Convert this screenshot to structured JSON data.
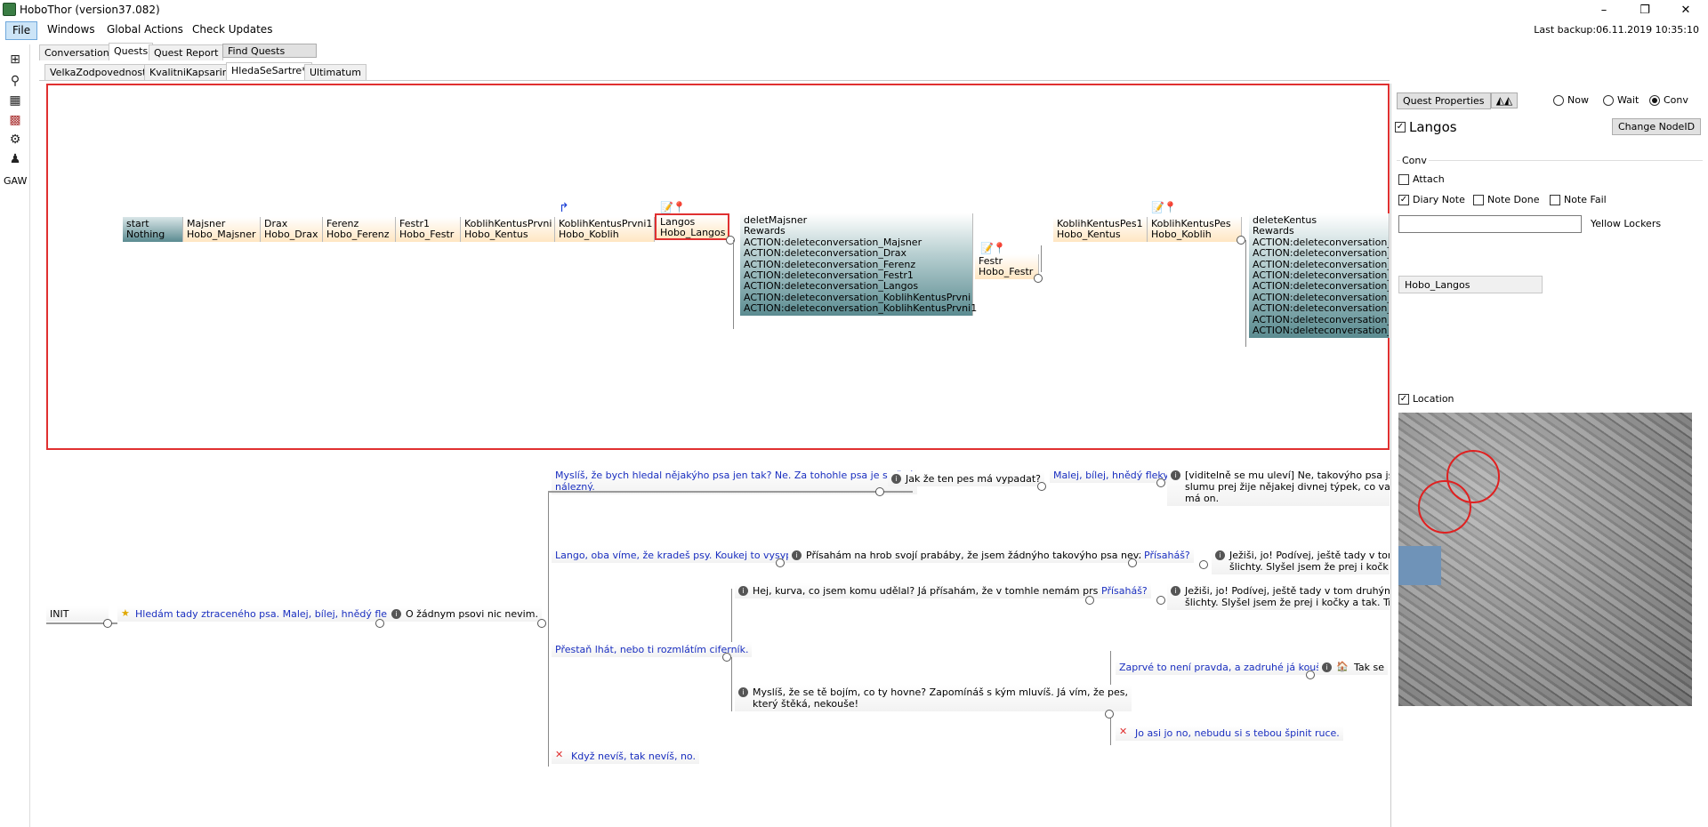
{
  "app": {
    "title": "HoboThor (version37.082)",
    "last_backup": "Last backup:06.11.2019 10:35:10",
    "controls": [
      "–",
      "❐",
      "✕"
    ]
  },
  "menu": [
    "File",
    "Windows",
    "Global Actions",
    "Check Updates"
  ],
  "left_toolbar": {
    "icons": [
      "add-node-icon",
      "fork-icon",
      "map-pin-icon",
      "map-icon",
      "gear-map-icon",
      "person-walk-icon"
    ],
    "gaw_label": "GAW"
  },
  "main_tabs": [
    "Conversations",
    "Quests",
    "Quest Report"
  ],
  "find_quests": "Find Quests",
  "quest_tabs": [
    "VelkaZodpovednost*",
    "KvalitniKapsarina",
    "HledaSeSartre*",
    "Ultimatum"
  ],
  "quest_nodes": [
    {
      "title": "start",
      "subtitle": "Nothing"
    },
    {
      "title": "Majsner",
      "subtitle": "Hobo_Majsner"
    },
    {
      "title": "Drax",
      "subtitle": "Hobo_Drax"
    },
    {
      "title": "Ferenz",
      "subtitle": "Hobo_Ferenz"
    },
    {
      "title": "Festr1",
      "subtitle": "Hobo_Festr"
    },
    {
      "title": "KoblihKentusPrvni",
      "subtitle": "Hobo_Kentus"
    },
    {
      "title": "KoblihKentusPrvni1",
      "subtitle": "Hobo_Koblih"
    },
    {
      "title": "Langos",
      "subtitle": "Hobo_Langos"
    },
    {
      "title": "Festr",
      "subtitle": "Hobo_Festr"
    },
    {
      "title": "KoblihKentusPes1",
      "subtitle": "Hobo_Kentus"
    },
    {
      "title": "KoblihKentusPes",
      "subtitle": "Hobo_Koblih"
    }
  ],
  "block_majsner": {
    "lines": [
      "deletMajsner",
      "Rewards",
      "ACTION:deleteconversation_Majsner",
      "ACTION:deleteconversation_Drax",
      "ACTION:deleteconversation_Ferenz",
      "ACTION:deleteconversation_Festr1",
      "ACTION:deleteconversation_Langos",
      "ACTION:deleteconversation_KoblihKentusPrvni",
      "ACTION:deleteconversation_KoblihKentusPrvni1"
    ]
  },
  "block_kentus": {
    "lines": [
      "deleteKentus",
      "Rewards",
      "ACTION:deleteconversation_M",
      "ACTION:deleteconversation_D",
      "ACTION:deleteconversation_Fe",
      "ACTION:deleteconversation_Fe",
      "ACTION:deleteconversation_La",
      "ACTION:deleteconversation_Ko",
      "ACTION:deleteconversation_Ko",
      "ACTION:deleteconversation_Ko",
      "ACTION:deleteconversation_Ko"
    ]
  },
  "dialogue": {
    "init": "INIT",
    "start_line": "Hledám tady ztraceného psa. Malej, bílej, hnědý fleky.",
    "reply_none": "O žádnym psovi nic nevim.",
    "opt_mislis_1": "Myslíš, že bych hledal nějakýho psa jen tak? Ne. Za tohohle psa je slušný",
    "opt_mislis_2": "nálezný.",
    "reply_jak": "Jak že ten pes má vypadat?",
    "opt_malej": "Malej, bílej, hnědý fleky.",
    "reply_viditelne_1": "[viditelně se mu uleví] Ne, takovýho psa jsem",
    "reply_viditelne_2": "slumu prej žije nějakej divnej týpek, co vaří v",
    "reply_viditelne_3": "má on.",
    "opt_lango": "Lango, oba víme, že kradeš psy. Koukej to vysypat.",
    "reply_prisaham": "Přísahám na hrob svojí prabáby, že jsem žádnýho takovýho psa nevzal.",
    "opt_prisahas_1": "Přísaháš?",
    "reply_jezisi_1a": "Ježiši, jo! Podívej, ještě tady v tom",
    "reply_jezisi_1b": "šlichty. Slyšel jsem že prej i kočk",
    "reply_hej": "Hej, kurva, co jsem komu udělal? Já přísahám, že v tomhle nemám prsty!",
    "opt_prisahas_2": "Přísaháš?",
    "reply_jezisi_2a": "Ježiši, jo! Podívej, ještě tady v tom druhým s",
    "reply_jezisi_2b": "šlichty. Slyšel jsem že prej i kočky a tak. Tře",
    "opt_prestan": "Přestaň lhát, nebo ti rozmlátím ciferník.",
    "reply_myslis_bojim_1": "Myslíš, že se tě bojím, co ty hovne? Zapomínáš s kým mluvíš. Já vím, že pes,",
    "reply_myslis_bojim_2": "který štěká, nekouše!",
    "opt_zaprve": "Zaprvé to není pravda, a zadruhé já koušu!",
    "reply_tak": "Tak se",
    "opt_jo_asi": "Jo asi jo no, nebudu si s tebou špinit ruce.",
    "opt_kdyz": "Když nevíš, tak nevíš, no."
  },
  "right_panel": {
    "quest_properties": "Quest Properties",
    "radio": [
      "Now",
      "Wait",
      "Conv"
    ],
    "radio_selected": "Conv",
    "node_name": "Langos",
    "node_checked": true,
    "change_nodeid": "Change NodeID",
    "conv_group": "Conv",
    "attach": "Attach",
    "attach_checked": false,
    "diary_note": "Diary Note",
    "diary_checked": true,
    "note_done": "Note Done",
    "note_done_checked": false,
    "note_fail": "Note Fail",
    "note_fail_checked": false,
    "yellow_lockers": "Yellow Lockers",
    "yellow_value": "",
    "hobo_field": "Hobo_Langos",
    "location": "Location",
    "location_checked": true
  }
}
